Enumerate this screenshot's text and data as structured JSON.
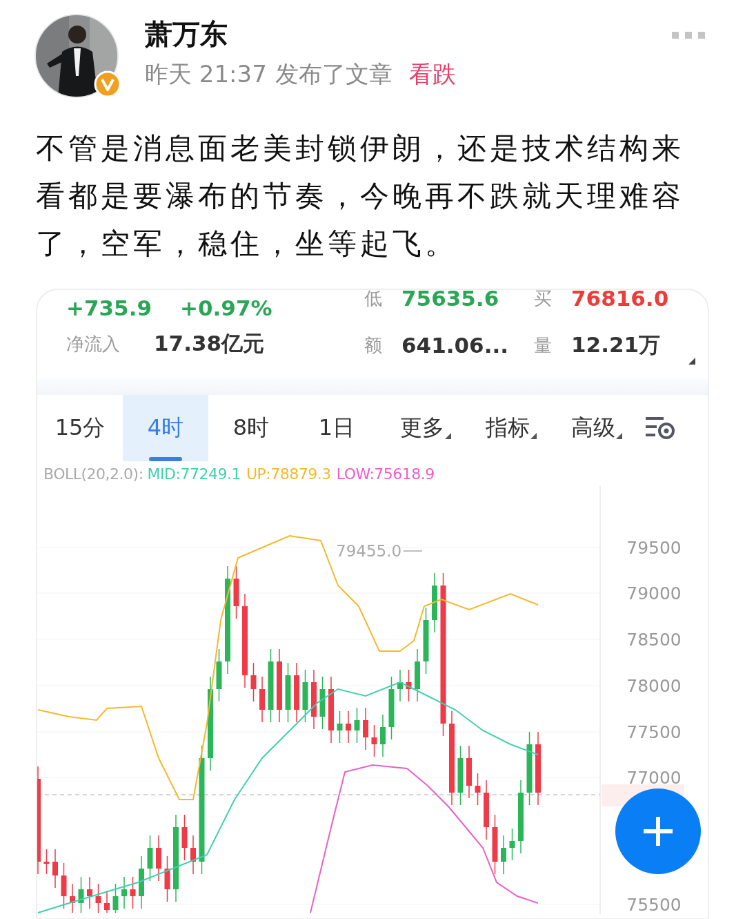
{
  "post": {
    "author": "萧万东",
    "verified": true,
    "time": "昨天 21:37",
    "action": "发布了文章",
    "tag": "看跌",
    "text": "不管是消息面老美封锁伊朗，还是技术结构来看都是要瀑布的节奏，今晚再不跌就天理难容了，空军，稳住，坐等起飞。"
  },
  "market": {
    "change": "+735.9",
    "change_pct": "+0.97%",
    "net_inflow": {
      "label": "净流入",
      "value": "17.38亿元"
    },
    "quotes": [
      {
        "label": "低",
        "value": "75635.6",
        "color": "#2aa656"
      },
      {
        "label": "买",
        "value": "76816.0",
        "color": "#ee3b3b"
      },
      {
        "label": "额",
        "value": "641.06...",
        "color": "#333333"
      },
      {
        "label": "量",
        "value": "12.21万",
        "color": "#333333"
      }
    ],
    "tabs": [
      {
        "label": "15分",
        "selected": false,
        "kind": "plain"
      },
      {
        "label": "4时",
        "selected": true,
        "kind": "plain"
      },
      {
        "label": "8时",
        "selected": false,
        "kind": "plain"
      },
      {
        "label": "1日",
        "selected": false,
        "kind": "plain"
      },
      {
        "label": "更多",
        "selected": false,
        "kind": "dropdown"
      },
      {
        "label": "指标",
        "selected": false,
        "kind": "dropdown"
      },
      {
        "label": "高级",
        "selected": false,
        "kind": "dropdown"
      }
    ],
    "indicator": {
      "name": "BOLL(20,2.0):",
      "lines": [
        {
          "label": "MID:77249.1",
          "color": "#3fd1b0"
        },
        {
          "label": "UP:78879.3",
          "color": "#f5b82e"
        },
        {
          "label": "LOW:75618.9",
          "color": "#ec5fc8"
        }
      ]
    },
    "chart": {
      "high_label": "79455.0",
      "price_axis": [
        "79500",
        "79000",
        "78500",
        "78000",
        "77500",
        "77000",
        "75500"
      ]
    }
  }
}
